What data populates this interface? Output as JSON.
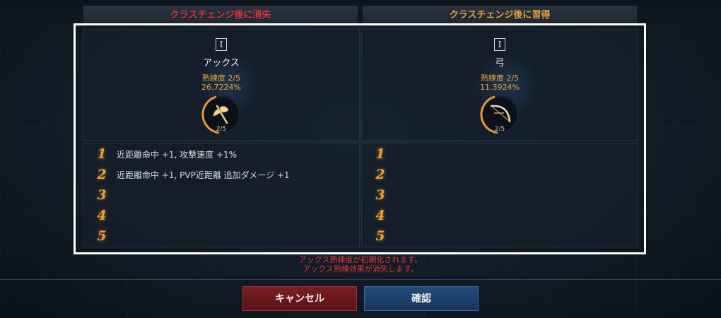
{
  "headers": {
    "left": "クラスチェンジ後に消失",
    "right": "クラスチェンジ後に習得"
  },
  "left_panel": {
    "tier": "I",
    "weapon": "アックス",
    "mastery_label": "熟練度 2/5",
    "mastery_pct": "26.7224%",
    "ring_level": "2/5",
    "progress": 0.267,
    "icon": "axe-icon",
    "bonuses": [
      {
        "num": "1",
        "text": "近距離命中 +1, 攻撃速度 +1%"
      },
      {
        "num": "2",
        "text": "近距離命中 +1, PVP近距離 追加ダメージ +1"
      },
      {
        "num": "3",
        "text": ""
      },
      {
        "num": "4",
        "text": ""
      },
      {
        "num": "5",
        "text": ""
      }
    ]
  },
  "right_panel": {
    "tier": "I",
    "weapon": "弓",
    "mastery_label": "熟練度 2/5",
    "mastery_pct": "11.3924%",
    "ring_level": "2/5",
    "progress": 0.114,
    "icon": "bow-icon",
    "bonuses": [
      {
        "num": "1",
        "text": ""
      },
      {
        "num": "2",
        "text": ""
      },
      {
        "num": "3",
        "text": ""
      },
      {
        "num": "4",
        "text": ""
      },
      {
        "num": "5",
        "text": ""
      }
    ]
  },
  "warning": {
    "line1": "アックス熟練度が初期化されます。",
    "line2": "アックス熟練効果が消失します。"
  },
  "buttons": {
    "cancel": "キャンセル",
    "confirm": "確認"
  },
  "colors": {
    "accent_orange": "#e3a23a",
    "warning_red": "#d83a3a",
    "cancel_red": "#7a1e22",
    "confirm_blue": "#234a7a"
  }
}
